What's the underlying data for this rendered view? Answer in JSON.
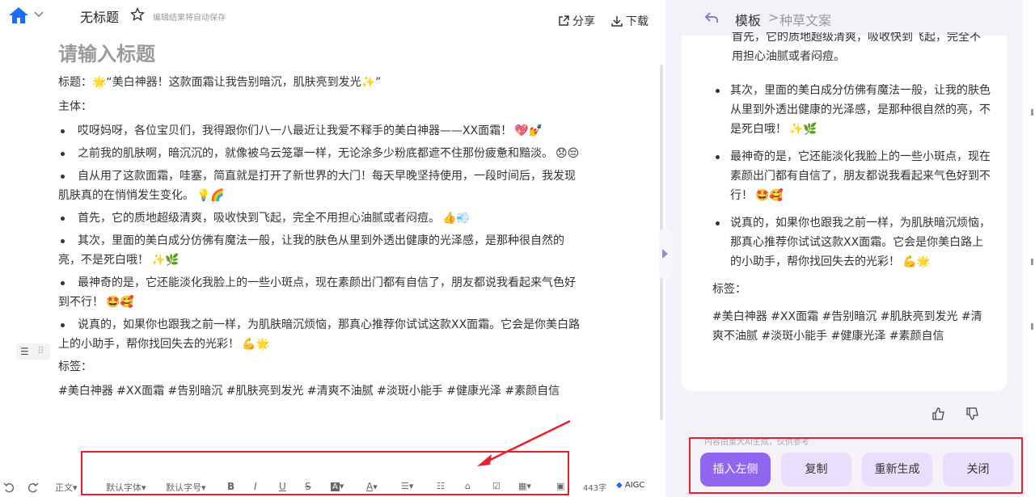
{
  "editor": {
    "doc_title": "无标题",
    "autosave_hint": "编辑结果将自动保存",
    "share_label": "分享",
    "download_label": "下载",
    "title_placeholder": "请输入标题",
    "title_line": "标题：🌟“美白神器！这款面霜让我告别暗沉，肌肤亮到发光✨”",
    "body_label": "主体：",
    "bullets": [
      {
        "text": "哎呀妈呀，各位宝贝们，我得跟你们八一八最近让我爱不释手的美白神器——XX面霜！",
        "emoji": "💖💅"
      },
      {
        "text": "之前我的肌肤啊，暗沉沉的，就像被乌云笼罩一样，无论涂多少粉底都遮不住那份疲惫和黯淡。",
        "emoji": "😞😔"
      },
      {
        "text": "自从用了这款面霜，哇塞，简直就是打开了新世界的大门！每天早晚坚持使用，一段时间后，我发现肌肤真的在悄悄发生变化。",
        "emoji": "💡🌈"
      },
      {
        "text": "首先，它的质地超级清爽，吸收快到飞起，完全不用担心油腻或者闷痘。",
        "emoji": "👍💨"
      },
      {
        "text": "其次，里面的美白成分仿佛有魔法一般，让我的肤色从里到外透出健康的光泽感，是那种很自然的亮，不是死白哦！",
        "emoji": "✨🌿"
      },
      {
        "text": "最神奇的是，它还能淡化我脸上的一些小斑点，现在素颜出门都有自信了，朋友都说我看起来气色好到不行！",
        "emoji": "🤩🥰"
      },
      {
        "text": "说真的，如果你也跟我之前一样，为肌肤暗沉烦恼，那真心推荐你试试这款XX面霜。它会是你美白路上的小助手，帮你找回失去的光彩！",
        "emoji": "💪🌟"
      }
    ],
    "tags_label": "标签：",
    "tags": "#美白神器 #XX面霜 #告别暗沉 #肌肤亮到发光 #清爽不油腻 #淡斑小能手 #健康光泽 #素颜自信"
  },
  "toolbar": {
    "style": "正文",
    "font": "默认字体",
    "font_size": "默认字号",
    "bold": "B",
    "italic": "I",
    "underline": "U",
    "strike": "S",
    "highlight": "A",
    "font_color": "A",
    "word_count": "443字",
    "aigc": "AIGC"
  },
  "panel": {
    "crumb_root": "模板",
    "crumb_sep": ">",
    "crumb_current": "种草文案",
    "partial_first": "首先，它的质地超级清爽，吸收快到飞起，完全不用担心油腻或者闷痘。",
    "bullets": [
      {
        "text": "首先，它的质地超级清爽，吸收快到飞起，完全不用担心油腻或者闷痘。",
        "emoji": "👍💨"
      },
      {
        "text": "其次，里面的美白成分仿佛有魔法一般，让我的肤色从里到外透出健康的光泽感，是那种很自然的亮，不是死白哦！",
        "emoji": "✨🌿"
      },
      {
        "text": "最神奇的是，它还能淡化我脸上的一些小斑点，现在素颜出门都有自信了，朋友都说我看起来气色好到不行！",
        "emoji": "🤩🥰"
      },
      {
        "text": "说真的，如果你也跟我之前一样，为肌肤暗沉烦恼，那真心推荐你试试这款XX面霜。它会是你美白路上的小助手，帮你找回失去的光彩！",
        "emoji": "💪🌟"
      }
    ],
    "tags_label": "标签：",
    "tags": "#美白神器 #XX面霜 #告别暗沉 #肌肤亮到发光 #清爽不油腻 #淡斑小能手 #健康光泽 #素颜自信",
    "disclaimer": "内容由重大AI生成，仅供参考",
    "insert_left": "插入左侧",
    "copy": "复制",
    "regenerate": "重新生成",
    "close": "关闭"
  },
  "colors": {
    "accent": "#9066f0",
    "accent_light": "#e9defb",
    "highlight_box": "#e8202a",
    "home_blue": "#1a6dff"
  }
}
